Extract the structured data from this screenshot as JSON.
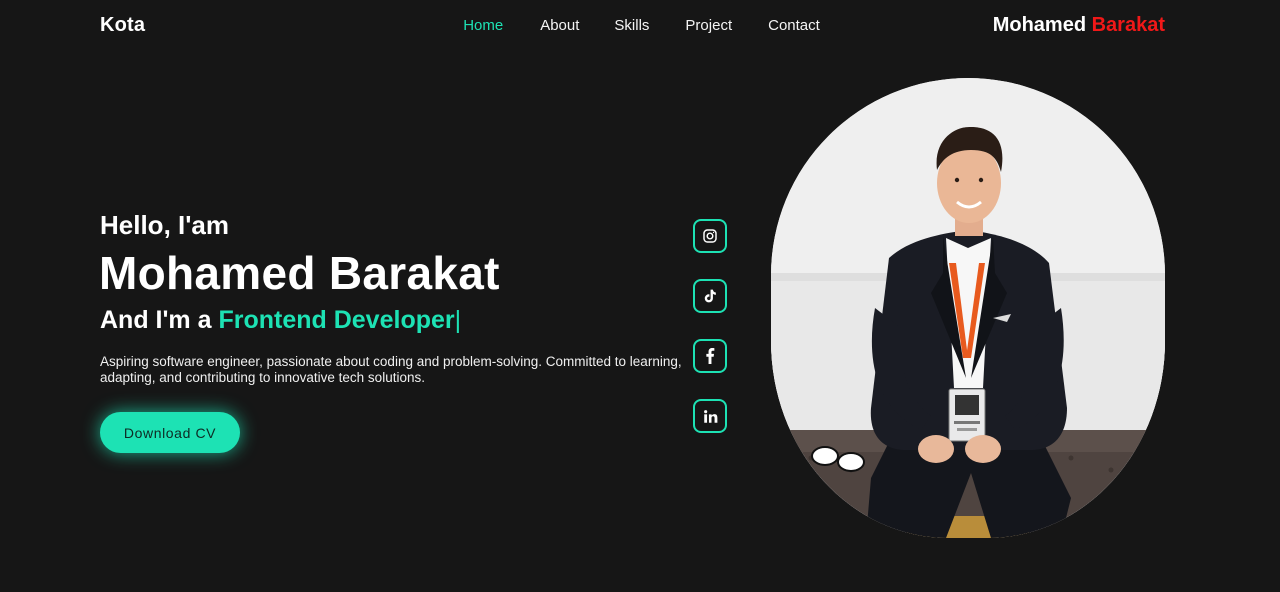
{
  "header": {
    "logo": "Kota",
    "nav": [
      {
        "label": "Home",
        "active": true
      },
      {
        "label": "About",
        "active": false
      },
      {
        "label": "Skills",
        "active": false
      },
      {
        "label": "Project",
        "active": false
      },
      {
        "label": "Contact",
        "active": false
      }
    ],
    "brand_first": "Mohamed",
    "brand_last": "Barakat"
  },
  "hero": {
    "greeting": "Hello, I'am",
    "name": "Mohamed Barakat",
    "role_prefix": "And I'm a",
    "role_typed": "Frontend Developer",
    "caret": "|",
    "description": "Aspiring software engineer, passionate about coding and problem-solving. Committed to learning, adapting, and contributing to innovative tech solutions.",
    "cta_label": "Download CV"
  },
  "social": [
    {
      "icon": "instagram-icon"
    },
    {
      "icon": "tiktok-icon"
    },
    {
      "icon": "facebook-icon"
    },
    {
      "icon": "linkedin-icon"
    }
  ],
  "colors": {
    "background": "#161616",
    "accent": "#1de2b4",
    "brand_red": "#f11818"
  }
}
